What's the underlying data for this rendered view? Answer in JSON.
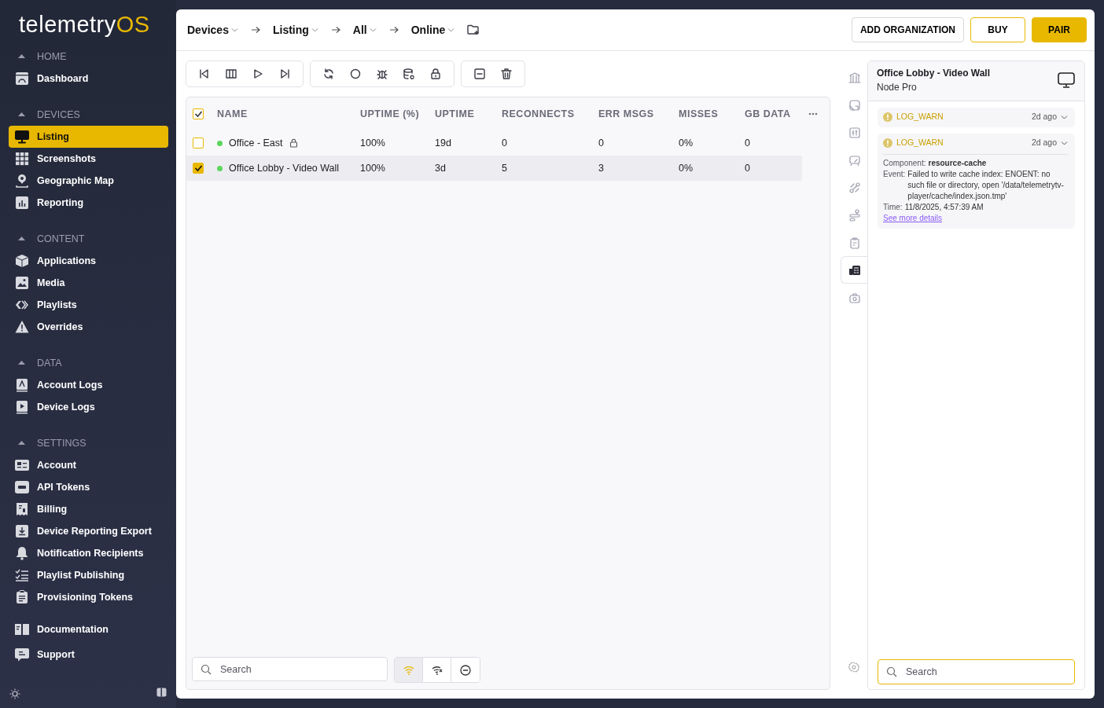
{
  "logo": {
    "text": "telemetry",
    "accent": "OS"
  },
  "sidebar": {
    "sections": [
      {
        "title": "HOME",
        "expanded": true,
        "items": [
          {
            "label": "Dashboard",
            "selected": false
          }
        ]
      },
      {
        "title": "DEVICES",
        "expanded": true,
        "items": [
          {
            "label": "Listing",
            "selected": true
          },
          {
            "label": "Screenshots",
            "selected": false
          },
          {
            "label": "Geographic Map",
            "selected": false
          },
          {
            "label": "Reporting",
            "selected": false
          }
        ]
      },
      {
        "title": "CONTENT",
        "expanded": true,
        "items": [
          {
            "label": "Applications",
            "selected": false
          },
          {
            "label": "Media",
            "selected": false
          },
          {
            "label": "Playlists",
            "selected": false
          },
          {
            "label": "Overrides",
            "selected": false
          }
        ]
      },
      {
        "title": "DATA",
        "expanded": true,
        "items": [
          {
            "label": "Account Logs",
            "selected": false
          },
          {
            "label": "Device Logs",
            "selected": false
          }
        ]
      },
      {
        "title": "SETTINGS",
        "expanded": true,
        "items": [
          {
            "label": "Account",
            "selected": false
          },
          {
            "label": "API Tokens",
            "selected": false
          },
          {
            "label": "Billing",
            "selected": false
          },
          {
            "label": "Device Reporting Export",
            "selected": false
          },
          {
            "label": "Notification Recipients",
            "selected": false
          },
          {
            "label": "Playlist Publishing",
            "selected": false
          },
          {
            "label": "Provisioning Tokens",
            "selected": false
          }
        ]
      }
    ],
    "footer_items": [
      {
        "label": "Documentation"
      },
      {
        "label": "Support"
      }
    ]
  },
  "breadcrumb": [
    {
      "label": "Devices"
    },
    {
      "label": "Listing"
    },
    {
      "label": "All"
    },
    {
      "label": "Online"
    }
  ],
  "header_buttons": [
    {
      "label": "ADD ORGANIZATION",
      "kind": "outline"
    },
    {
      "label": "BUY",
      "kind": "accent-outline"
    },
    {
      "label": "PAIR",
      "kind": "filled"
    }
  ],
  "table": {
    "select_all": true,
    "columns": [
      "NAME",
      "UPTIME (%)",
      "UPTIME",
      "RECONNECTS",
      "ERR MSGS",
      "MISSES",
      "GB DATA"
    ],
    "rows": [
      {
        "selected": false,
        "color": "#5cd65c",
        "locked": true,
        "cells": [
          "Office - East",
          "100%",
          "19d",
          "0",
          "0",
          "0%",
          "0"
        ]
      },
      {
        "selected": true,
        "color": "#5cd65c",
        "locked": false,
        "cells": [
          "Office Lobby - Video Wall",
          "100%",
          "3d",
          "5",
          "3",
          "0%",
          "0"
        ]
      }
    ]
  },
  "filters": {
    "search": {
      "placeholder": "Search"
    },
    "buttons": [
      {
        "selected": true
      },
      {
        "selected": false
      },
      {
        "selected": false
      }
    ]
  },
  "side_tabs": [
    {
      "selected": false
    },
    {
      "selected": false
    },
    {
      "selected": false
    },
    {
      "selected": false
    },
    {
      "selected": false
    },
    {
      "selected": false
    },
    {
      "selected": false
    },
    {
      "selected": true
    },
    {
      "selected": false
    }
  ],
  "detail": {
    "title": "Office Lobby - Video Wall",
    "subtitle": "Node Pro",
    "logs": [
      {
        "level": "LOG_WARN",
        "time": "2d ago"
      },
      {
        "level": "LOG_WARN",
        "time": "2d ago",
        "fields": [
          {
            "label": "Component:",
            "value": "resource-cache",
            "bold": true
          },
          {
            "label": "Event:",
            "value": "Failed to write cache index: ENOENT: no such file or directory, open '/data/telemetrytv-player/cache/index.json.tmp'",
            "bold": false
          },
          {
            "label": "Time:",
            "value": "11/8/2025, 4:57:39 AM",
            "bold": false
          }
        ],
        "link": "See more details"
      }
    ],
    "search": {
      "placeholder": "Search"
    }
  }
}
